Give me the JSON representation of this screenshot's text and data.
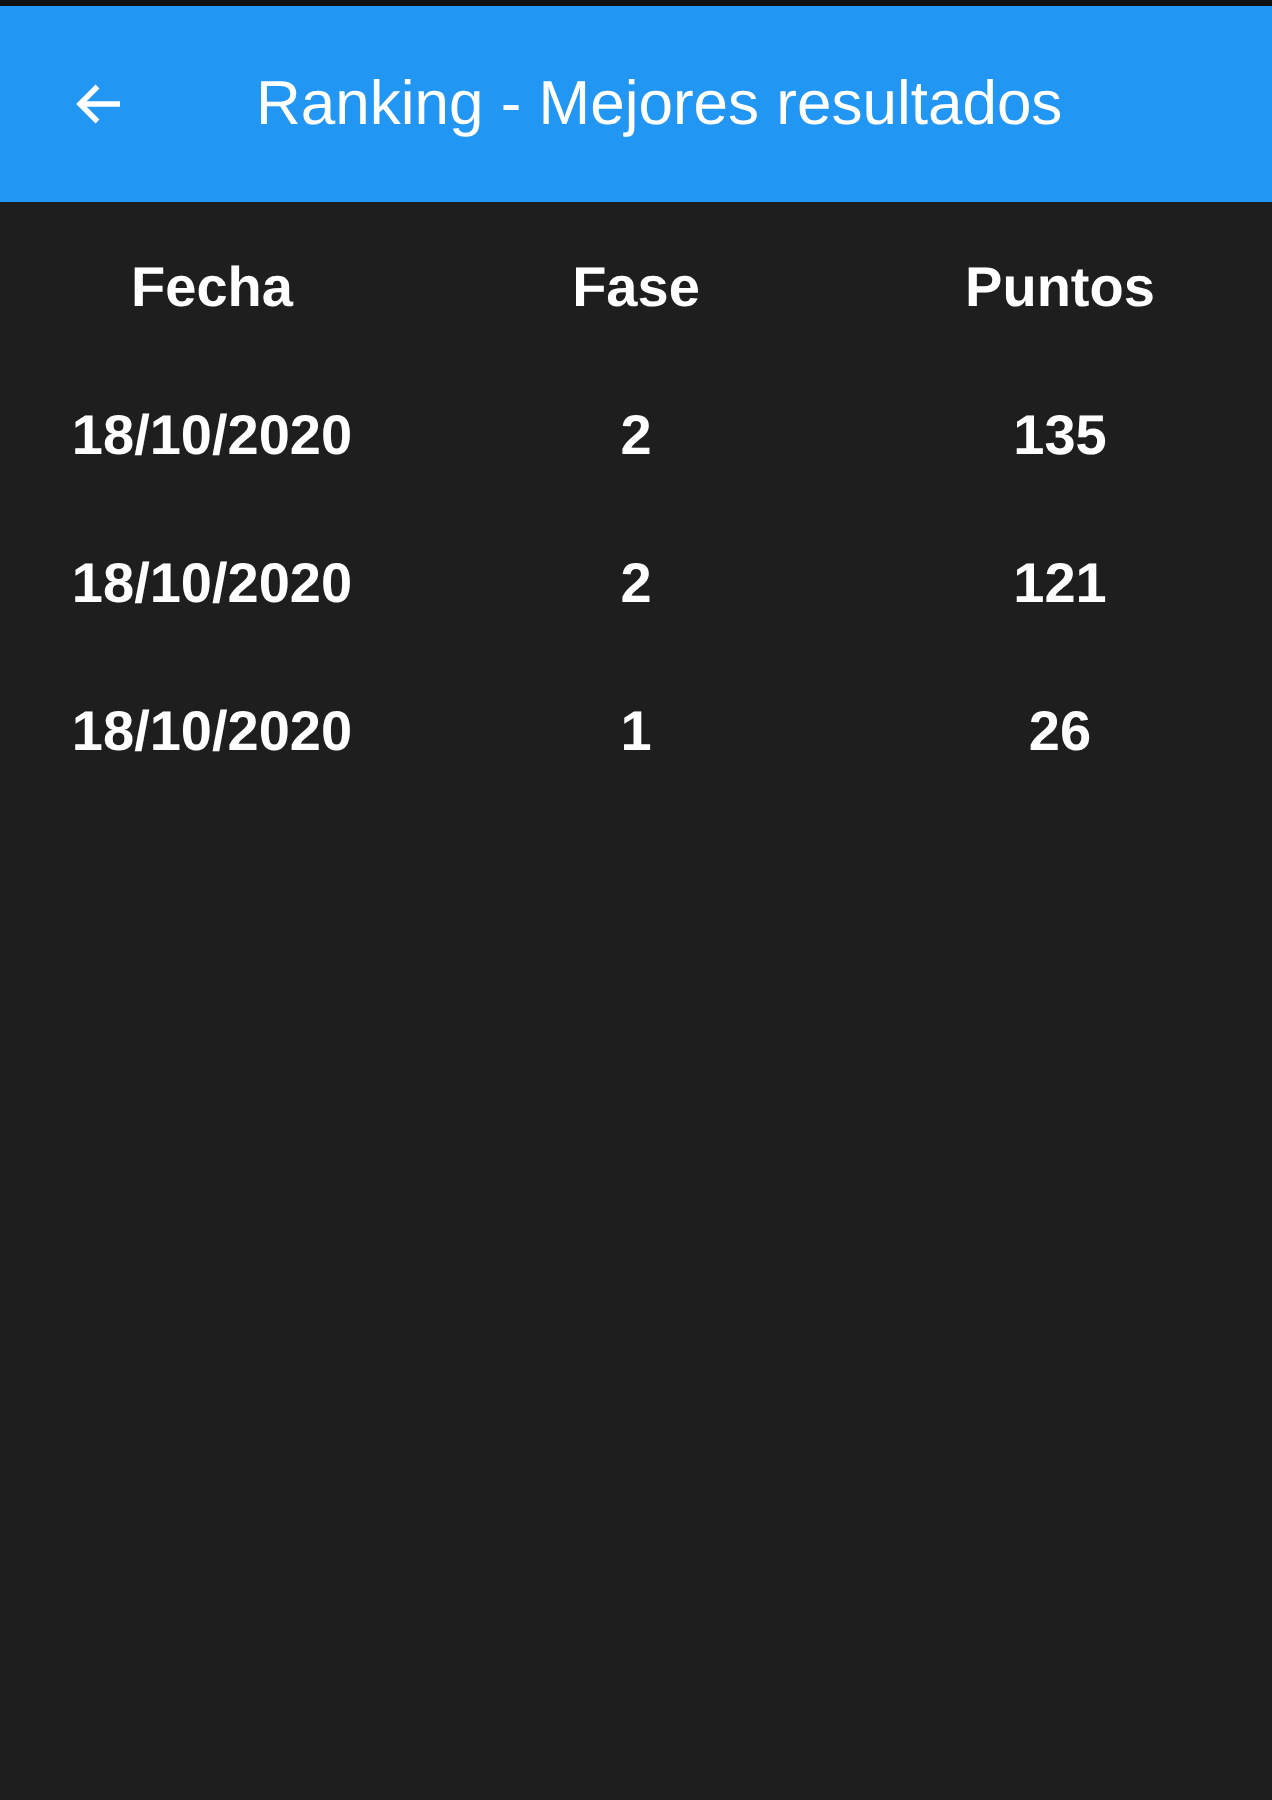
{
  "app_bar": {
    "title": "Ranking - Mejores resultados"
  },
  "table": {
    "columns": [
      "Fecha",
      "Fase",
      "Puntos"
    ],
    "rows": [
      [
        "18/10/2020",
        "2",
        "135"
      ],
      [
        "18/10/2020",
        "2",
        "121"
      ],
      [
        "18/10/2020",
        "1",
        "26"
      ]
    ]
  }
}
